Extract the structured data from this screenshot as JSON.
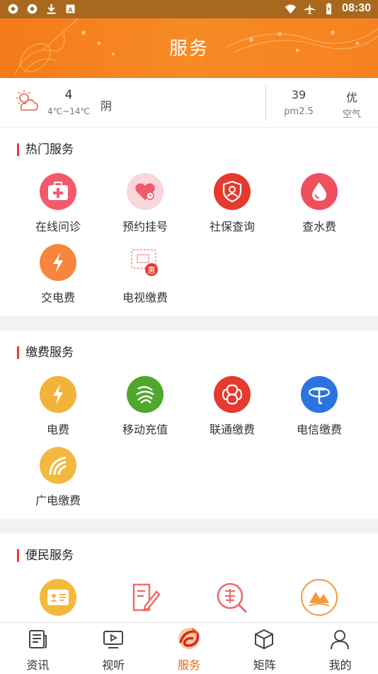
{
  "status_bar": {
    "time": "08:30",
    "left_icons": [
      "sync-icon",
      "sync-icon",
      "download-icon",
      "app-notification-icon"
    ],
    "right_icons": [
      "wifi-icon",
      "airplane-icon",
      "battery-icon"
    ]
  },
  "header": {
    "title": "服务"
  },
  "weather": {
    "icon": "cloudy-sun-icon",
    "temperature": "4",
    "range": "4℃~14℃",
    "condition": "阴",
    "pm_value": "39",
    "pm_label": "pm2.5",
    "air_value": "优",
    "air_label": "空气"
  },
  "sections": {
    "hot": {
      "title": "热门服务",
      "items": [
        {
          "label": "在线问诊",
          "icon": "medical-kit-icon",
          "color": "#f25a6b"
        },
        {
          "label": "预约挂号",
          "icon": "heart-clock-icon",
          "color": "#f6c9cf"
        },
        {
          "label": "社保查询",
          "icon": "shield-user-icon",
          "color": "#e53a2f"
        },
        {
          "label": "查水费",
          "icon": "water-drop-icon",
          "color": "#f04f5d"
        },
        {
          "label": "交电费",
          "icon": "lightning-icon",
          "color": "#f7853e"
        },
        {
          "label": "电视缴费",
          "icon": "tv-ticket-icon",
          "color": "#ffffff",
          "badge": "惠"
        }
      ]
    },
    "pay": {
      "title": "缴费服务",
      "items": [
        {
          "label": "电费",
          "icon": "lightning-icon",
          "color": "#f2b33a"
        },
        {
          "label": "移动充值",
          "icon": "china-mobile-icon",
          "color": "#4fa82c"
        },
        {
          "label": "联通缴费",
          "icon": "china-unicom-icon",
          "color": "#e53a2f"
        },
        {
          "label": "电信缴费",
          "icon": "china-telecom-icon",
          "color": "#2b74e0"
        },
        {
          "label": "广电缴费",
          "icon": "broadcast-icon",
          "color": "#f2b93f"
        }
      ]
    },
    "convenience": {
      "title": "便民服务",
      "items": [
        {
          "label": "",
          "icon": "id-card-icon",
          "color": "#f5b93a"
        },
        {
          "label": "",
          "icon": "edit-document-icon",
          "color": "#ffffff"
        },
        {
          "label": "",
          "icon": "search-violation-icon",
          "color": "#ffffff"
        },
        {
          "label": "",
          "icon": "landscape-icon",
          "color": "#ffffff"
        }
      ]
    }
  },
  "tabbar": {
    "tabs": [
      {
        "label": "资讯",
        "icon": "news-icon",
        "active": false
      },
      {
        "label": "视听",
        "icon": "video-icon",
        "active": false
      },
      {
        "label": "服务",
        "icon": "service-logo-icon",
        "active": true
      },
      {
        "label": "矩阵",
        "icon": "cube-icon",
        "active": false
      },
      {
        "label": "我的",
        "icon": "user-icon",
        "active": false
      }
    ]
  },
  "colors": {
    "accent": "#f47b1a",
    "title_bar_marker": "#e83a3a",
    "active_tab": "#e06b1f"
  }
}
